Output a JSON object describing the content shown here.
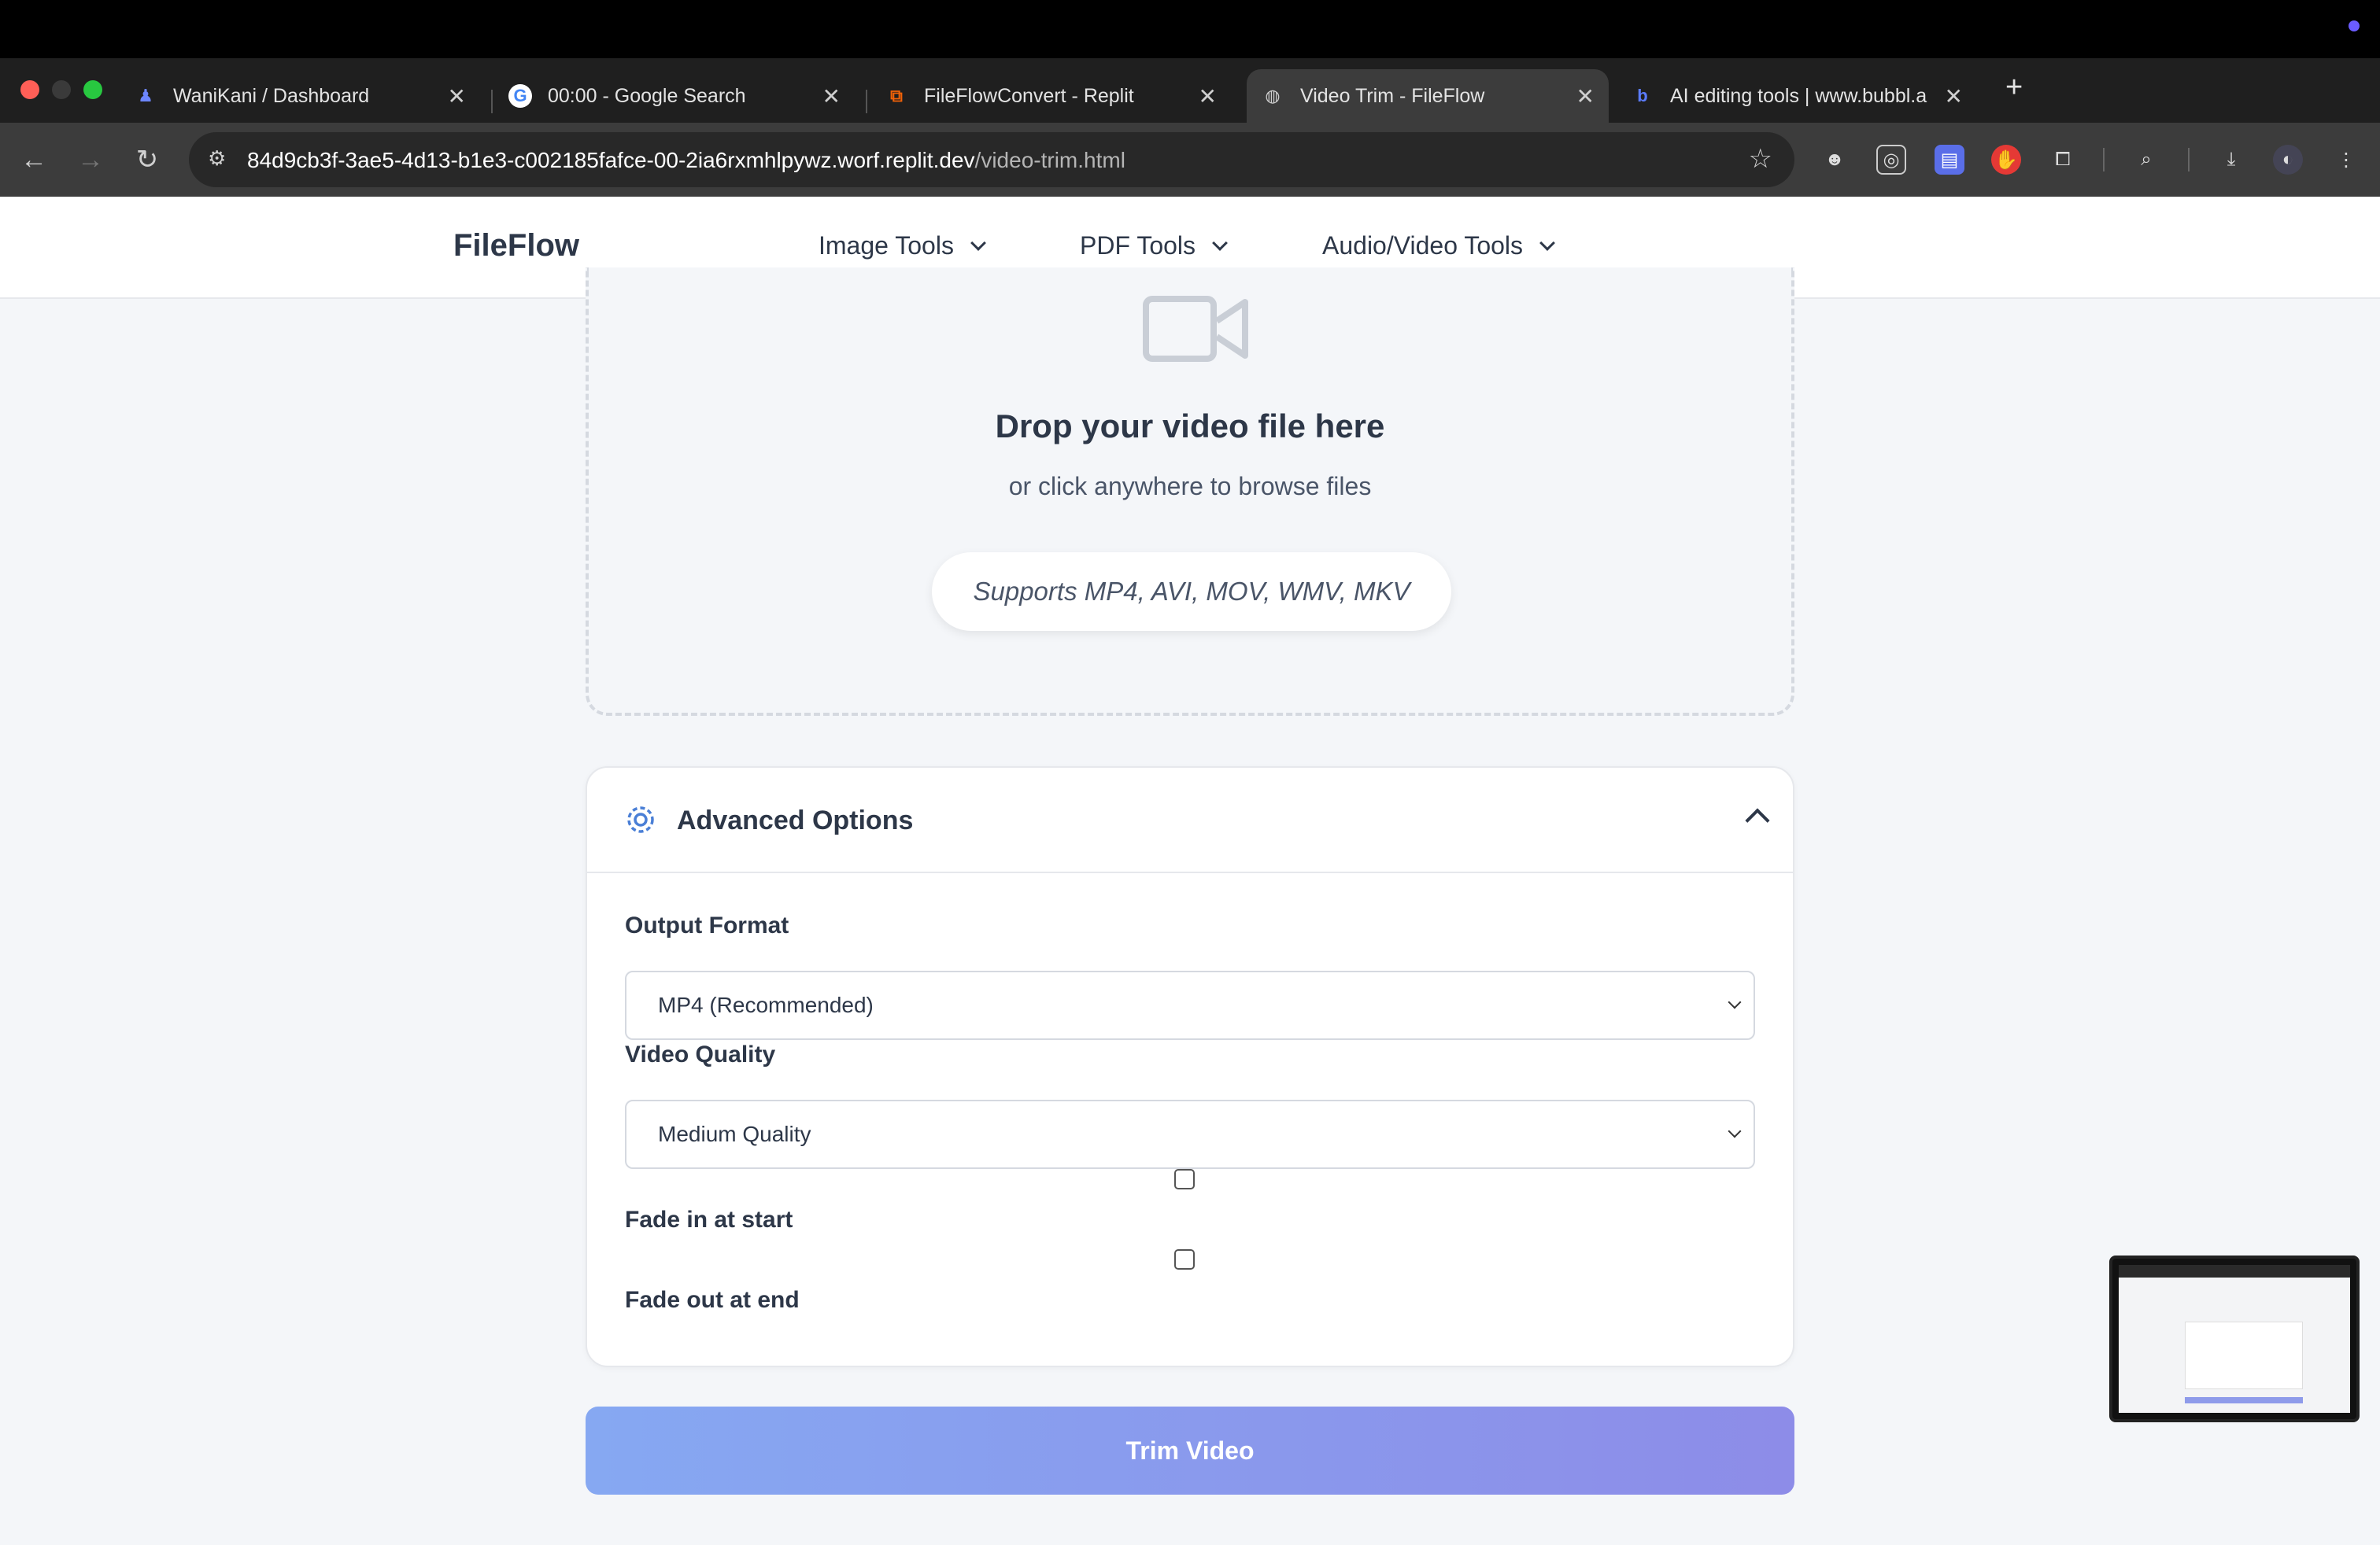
{
  "browser": {
    "tabs": [
      {
        "title": "WaniKani / Dashboard",
        "icon": "wanikani-icon",
        "active": false
      },
      {
        "title": "00:00 - Google Search",
        "icon": "google-icon",
        "active": false
      },
      {
        "title": "FileFlowConvert - Replit",
        "icon": "replit-icon",
        "active": false
      },
      {
        "title": "Video Trim - FileFlow",
        "icon": "globe-icon",
        "active": true
      },
      {
        "title": "AI editing tools | www.bubbl.a",
        "icon": "bubble-icon",
        "active": false
      }
    ],
    "new_tab_label": "+",
    "url_host": "84d9cb3f-3ae5-4d13-b1e3-c002185fafce-00-2ia6rxmhlpywz.worf.replit.dev",
    "url_path": "/video-trim.html"
  },
  "site": {
    "brand": "FileFlow",
    "nav": [
      {
        "label": "Image Tools"
      },
      {
        "label": "PDF Tools"
      },
      {
        "label": "Audio/Video Tools"
      }
    ]
  },
  "dropzone": {
    "title": "Drop your video file here",
    "subtitle": "or click anywhere to browse files",
    "supports": "Supports MP4, AVI, MOV, WMV, MKV"
  },
  "advanced": {
    "title": "Advanced Options",
    "output_format_label": "Output Format",
    "output_format_value": "MP4 (Recommended)",
    "video_quality_label": "Video Quality",
    "video_quality_value": "Medium Quality",
    "fade_in_label": "Fade in at start",
    "fade_in_checked": false,
    "fade_out_label": "Fade out at end",
    "fade_out_checked": false
  },
  "actions": {
    "trim_label": "Trim Video"
  },
  "colors": {
    "accent_gradient_start": "#86a8f2",
    "accent_gradient_end": "#8d8ce8",
    "gear_icon": "#4a7fd6"
  }
}
